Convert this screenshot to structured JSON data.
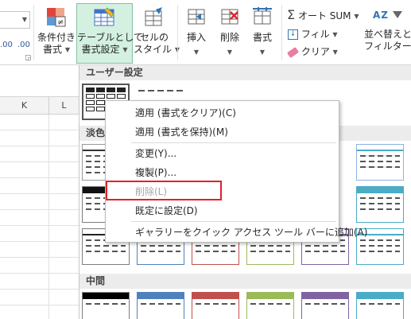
{
  "ribbon": {
    "partial_text": ".00",
    "partial_text2": ".00",
    "conditional_line1": "条件付き",
    "conditional_line2": "書式",
    "table_line1": "テーブルとして",
    "table_line2": "書式設定",
    "cell_line1": "セルの",
    "cell_line2": "スタイル",
    "insert_label": "挿入",
    "delete_label": "削除",
    "format_label": "書式",
    "autosum_label": "オート SUM",
    "fill_label": "フィル",
    "clear_label": "クリア",
    "sort_line1": "並べ替えと",
    "sort_line2": "フィルター",
    "sigma": "Σ",
    "sort_glyph": "AZ"
  },
  "sheet": {
    "col_k": "K",
    "col_l": "L"
  },
  "gallery": {
    "custom_header": "ユーザー設定",
    "light_header": "淡色",
    "medium_header": "中間",
    "light_colors": [
      "#ffffff",
      "#4f81bd",
      "#c0504d",
      "#9bbb59",
      "#8064a2",
      "#4bacc6"
    ],
    "medium_colors": [
      "#000000",
      "#4f81bd",
      "#c0504d",
      "#9bbb59",
      "#8064a2",
      "#4bacc6"
    ]
  },
  "menu": {
    "items": [
      {
        "label": "適用 (書式をクリア)(C)"
      },
      {
        "label": "適用 (書式を保持)(M)"
      },
      {
        "label": "変更(Y)..."
      },
      {
        "label": "複製(P)..."
      },
      {
        "label": "削除(L)"
      },
      {
        "label": "既定に設定(D)"
      },
      {
        "label": "ギャラリーをクイック アクセス ツール バーに追加(A)"
      }
    ]
  }
}
